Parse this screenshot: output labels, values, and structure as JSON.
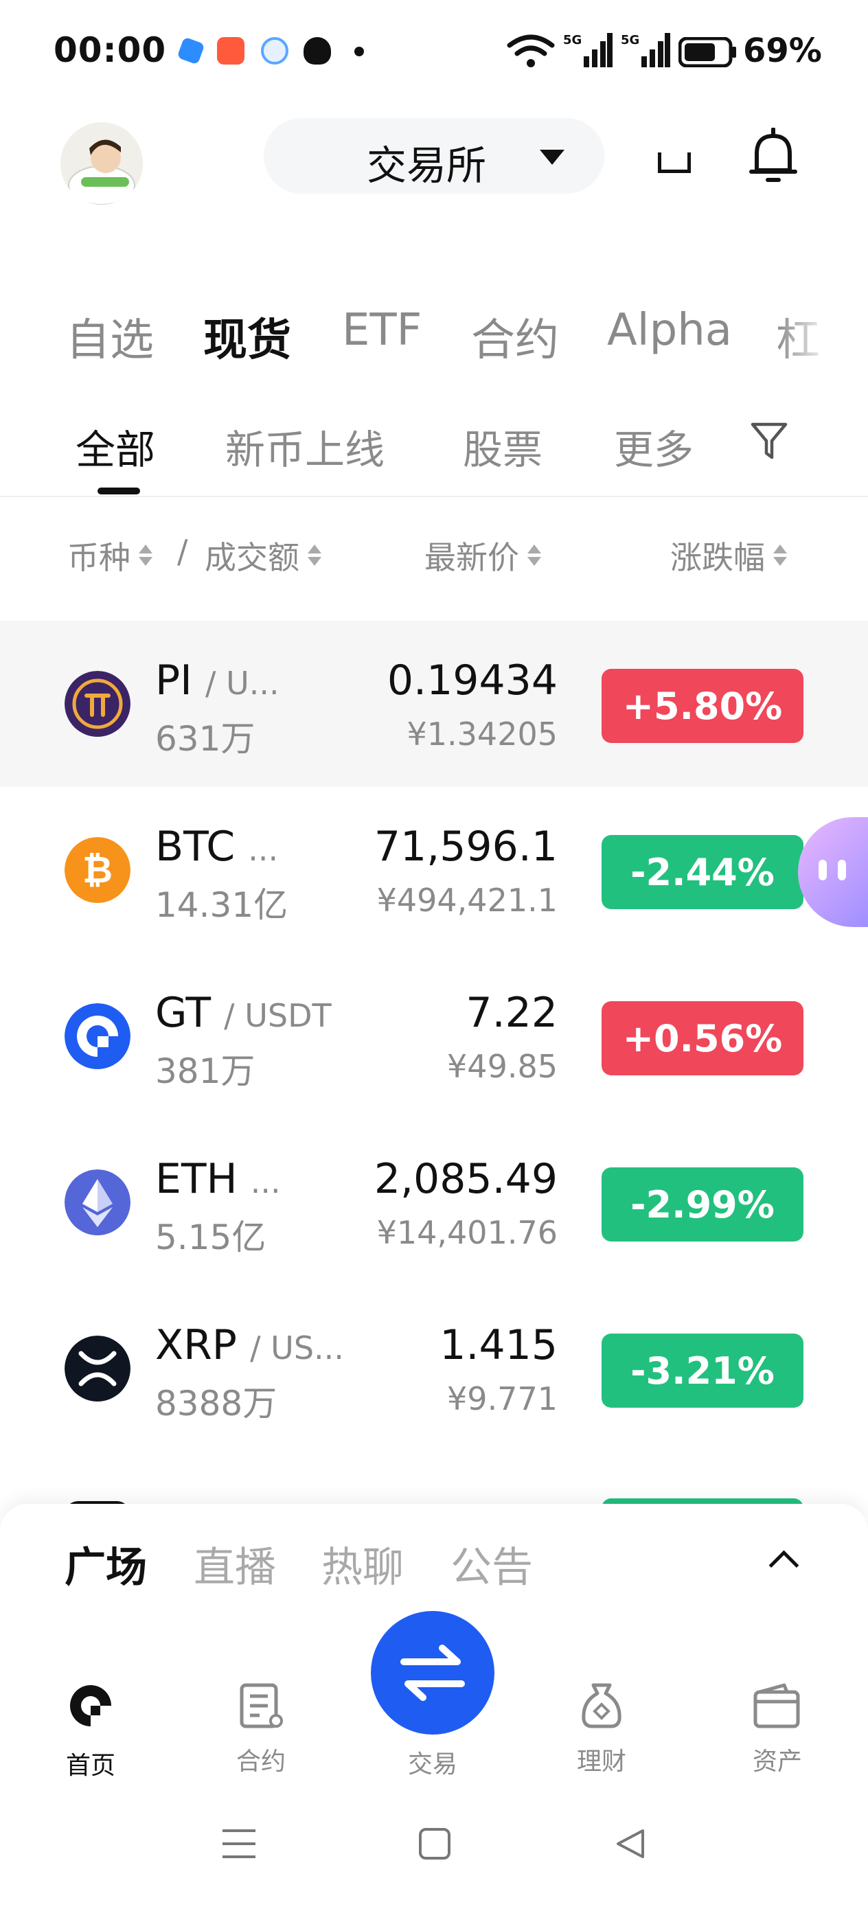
{
  "status_bar": {
    "time": "00:00",
    "battery": "69%"
  },
  "header": {
    "exchange_label": "交易所"
  },
  "category_tabs": [
    "自选",
    "现货",
    "ETF",
    "合约",
    "Alpha",
    "杠"
  ],
  "sub_tabs": [
    "全部",
    "新币上线",
    "股票",
    "更多"
  ],
  "columns": {
    "coin": "币种",
    "separator": "/",
    "volume": "成交额",
    "price": "最新价",
    "change": "涨跌幅"
  },
  "rows": [
    {
      "symbol": "PI",
      "quote": "/ U...",
      "volume": "631万",
      "price": "0.19434",
      "price_cny": "¥1.34205",
      "change": "+5.80%"
    },
    {
      "symbol": "BTC",
      "quote": "...",
      "volume": "14.31亿",
      "price": "71,596.1",
      "price_cny": "¥494,421.1",
      "change": "-2.44%"
    },
    {
      "symbol": "GT",
      "quote": "/ USDT",
      "volume": "381万",
      "price": "7.22",
      "price_cny": "¥49.85",
      "change": "+0.56%"
    },
    {
      "symbol": "ETH",
      "quote": "...",
      "volume": "5.15亿",
      "price": "2,085.49",
      "price_cny": "¥14,401.76",
      "change": "-2.99%"
    },
    {
      "symbol": "XRP",
      "quote": "/ US...",
      "volume": "8388万",
      "price": "1.415",
      "price_cny": "¥9.771",
      "change": "-3.21%"
    }
  ],
  "feed_tabs": [
    "广场",
    "直播",
    "热聊",
    "公告"
  ],
  "bottom_nav": [
    {
      "label": "首页",
      "icon": "home-icon"
    },
    {
      "label": "合约",
      "icon": "contract-icon"
    },
    {
      "label": "交易",
      "icon": "swap-icon"
    },
    {
      "label": "理财",
      "icon": "money-bag-icon"
    },
    {
      "label": "资产",
      "icon": "wallet-icon"
    }
  ],
  "colors": {
    "up": "#f0475a",
    "down": "#22c07e",
    "accent": "#1f5cf2"
  }
}
